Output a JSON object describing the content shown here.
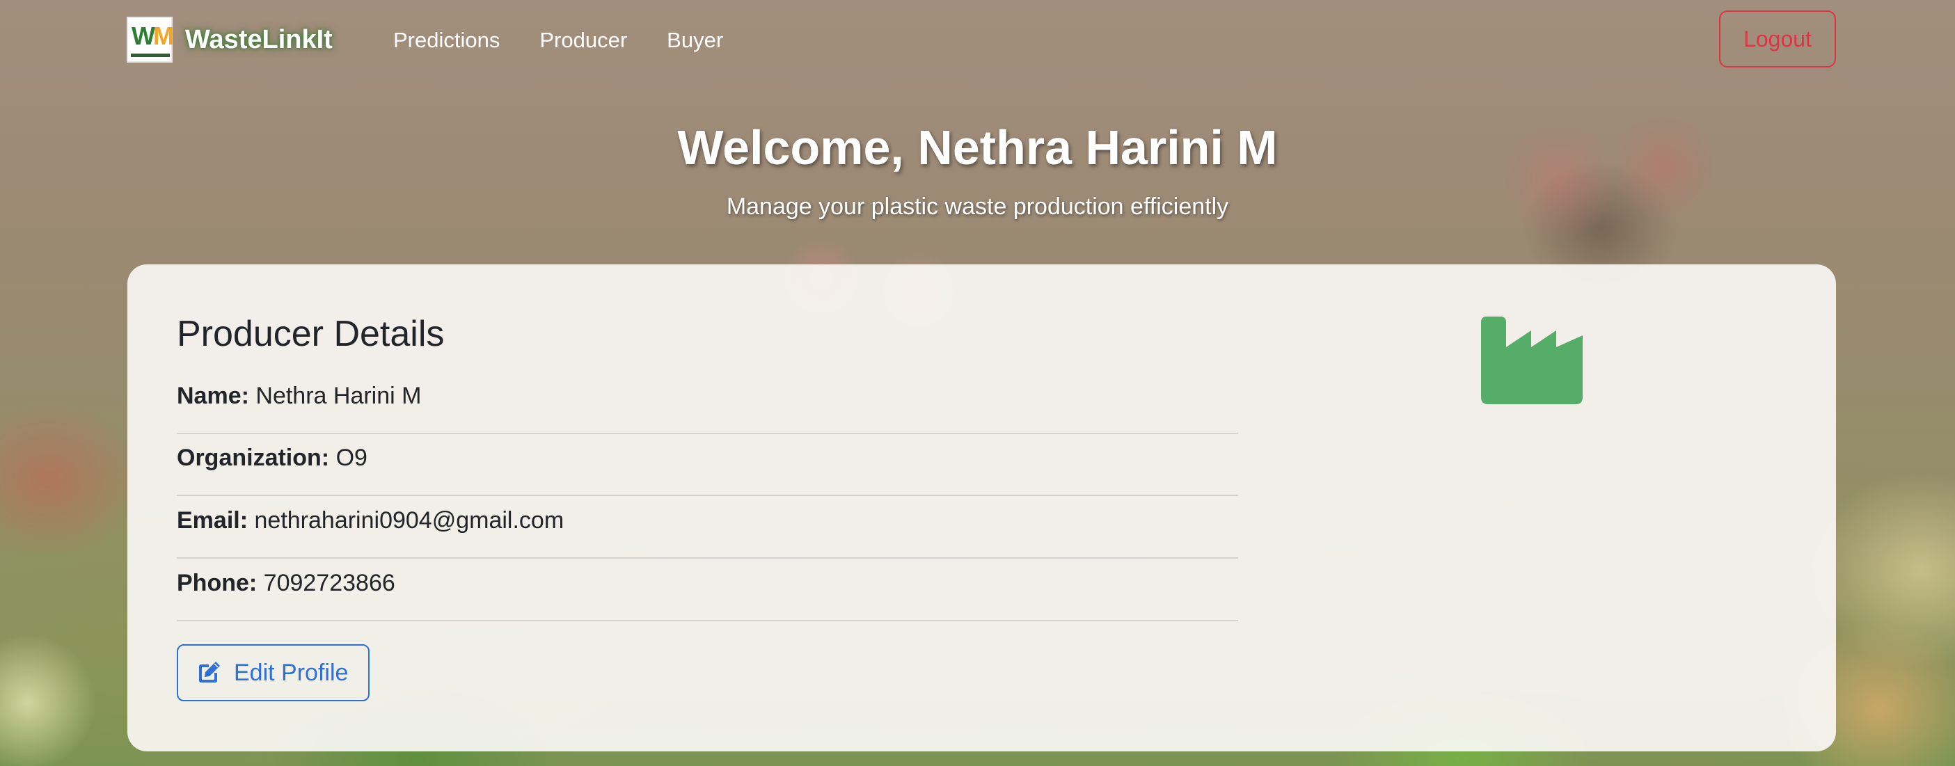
{
  "navbar": {
    "brand_logo_text_w": "W",
    "brand_logo_text_m": "M",
    "brand_name": "WasteLinkIt",
    "links": [
      {
        "label": "Predictions"
      },
      {
        "label": "Producer"
      },
      {
        "label": "Buyer"
      }
    ],
    "logout_label": "Logout"
  },
  "hero": {
    "title": "Welcome, Nethra Harini M",
    "subtitle": "Manage your plastic waste production efficiently"
  },
  "card": {
    "title": "Producer Details",
    "fields": [
      {
        "label": "Name:",
        "value": "Nethra Harini M"
      },
      {
        "label": "Organization:",
        "value": "O9"
      },
      {
        "label": "Email:",
        "value": "nethraharini0904@gmail.com"
      },
      {
        "label": "Phone:",
        "value": "7092723866"
      }
    ],
    "edit_button_label": "Edit Profile",
    "factory_icon": "factory-icon"
  },
  "colors": {
    "danger": "#dc3545",
    "primary": "#2f6fd6",
    "success": "#55ad68"
  }
}
